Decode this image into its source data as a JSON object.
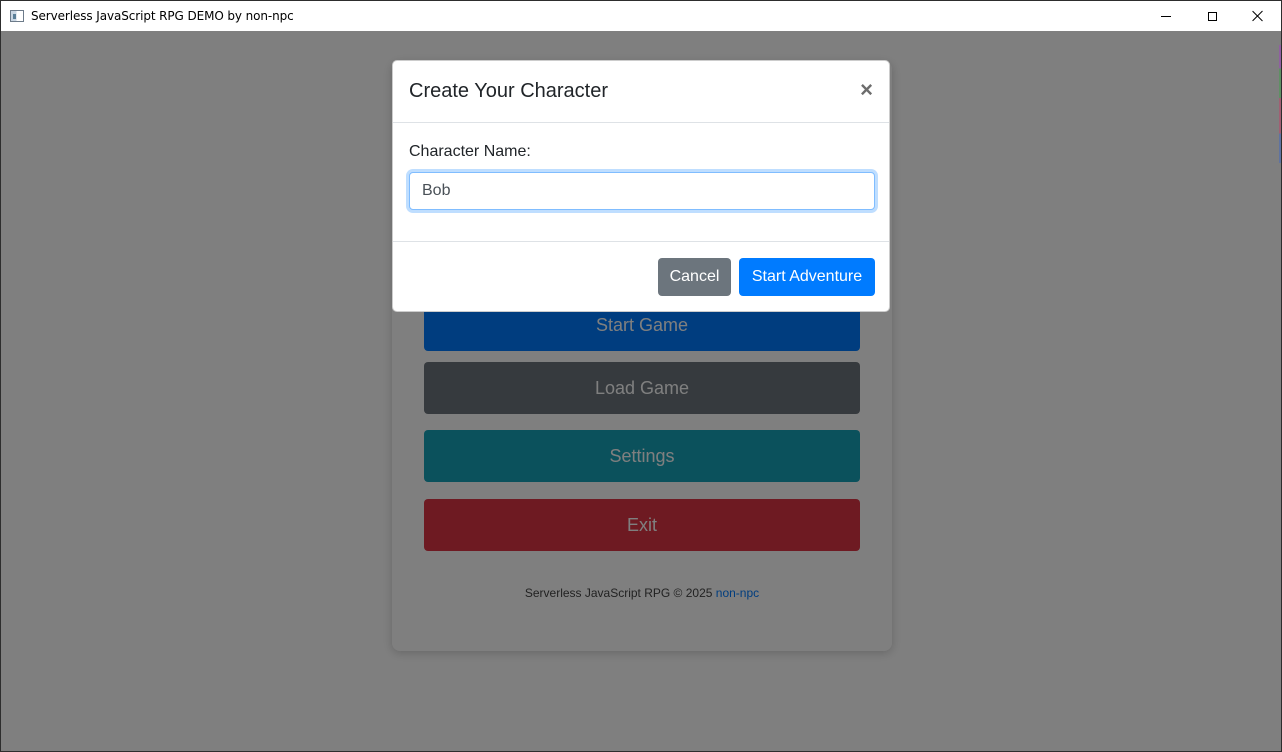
{
  "window": {
    "title": "Serverless JavaScript RPG DEMO by non-npc",
    "controls": [
      "minimize-icon",
      "maximize-icon",
      "close-icon"
    ]
  },
  "menu": {
    "buttons": {
      "start": "Start Game",
      "load": "Load Game",
      "settings": "Settings",
      "exit": "Exit"
    },
    "footer": {
      "text": "Serverless JavaScript RPG © 2025",
      "link": "non-npc"
    }
  },
  "modal": {
    "title": "Create Your Character",
    "close_glyph": "×",
    "name_label": "Character Name:",
    "name_value": "Bob",
    "cancel_label": "Cancel",
    "confirm_label": "Start Adventure"
  },
  "colors": {
    "primary": "#007bff",
    "secondary": "#6c757d",
    "info": "#17a2b8",
    "danger": "#dc3545",
    "backdrop": "rgba(0,0,0,0.5)"
  }
}
